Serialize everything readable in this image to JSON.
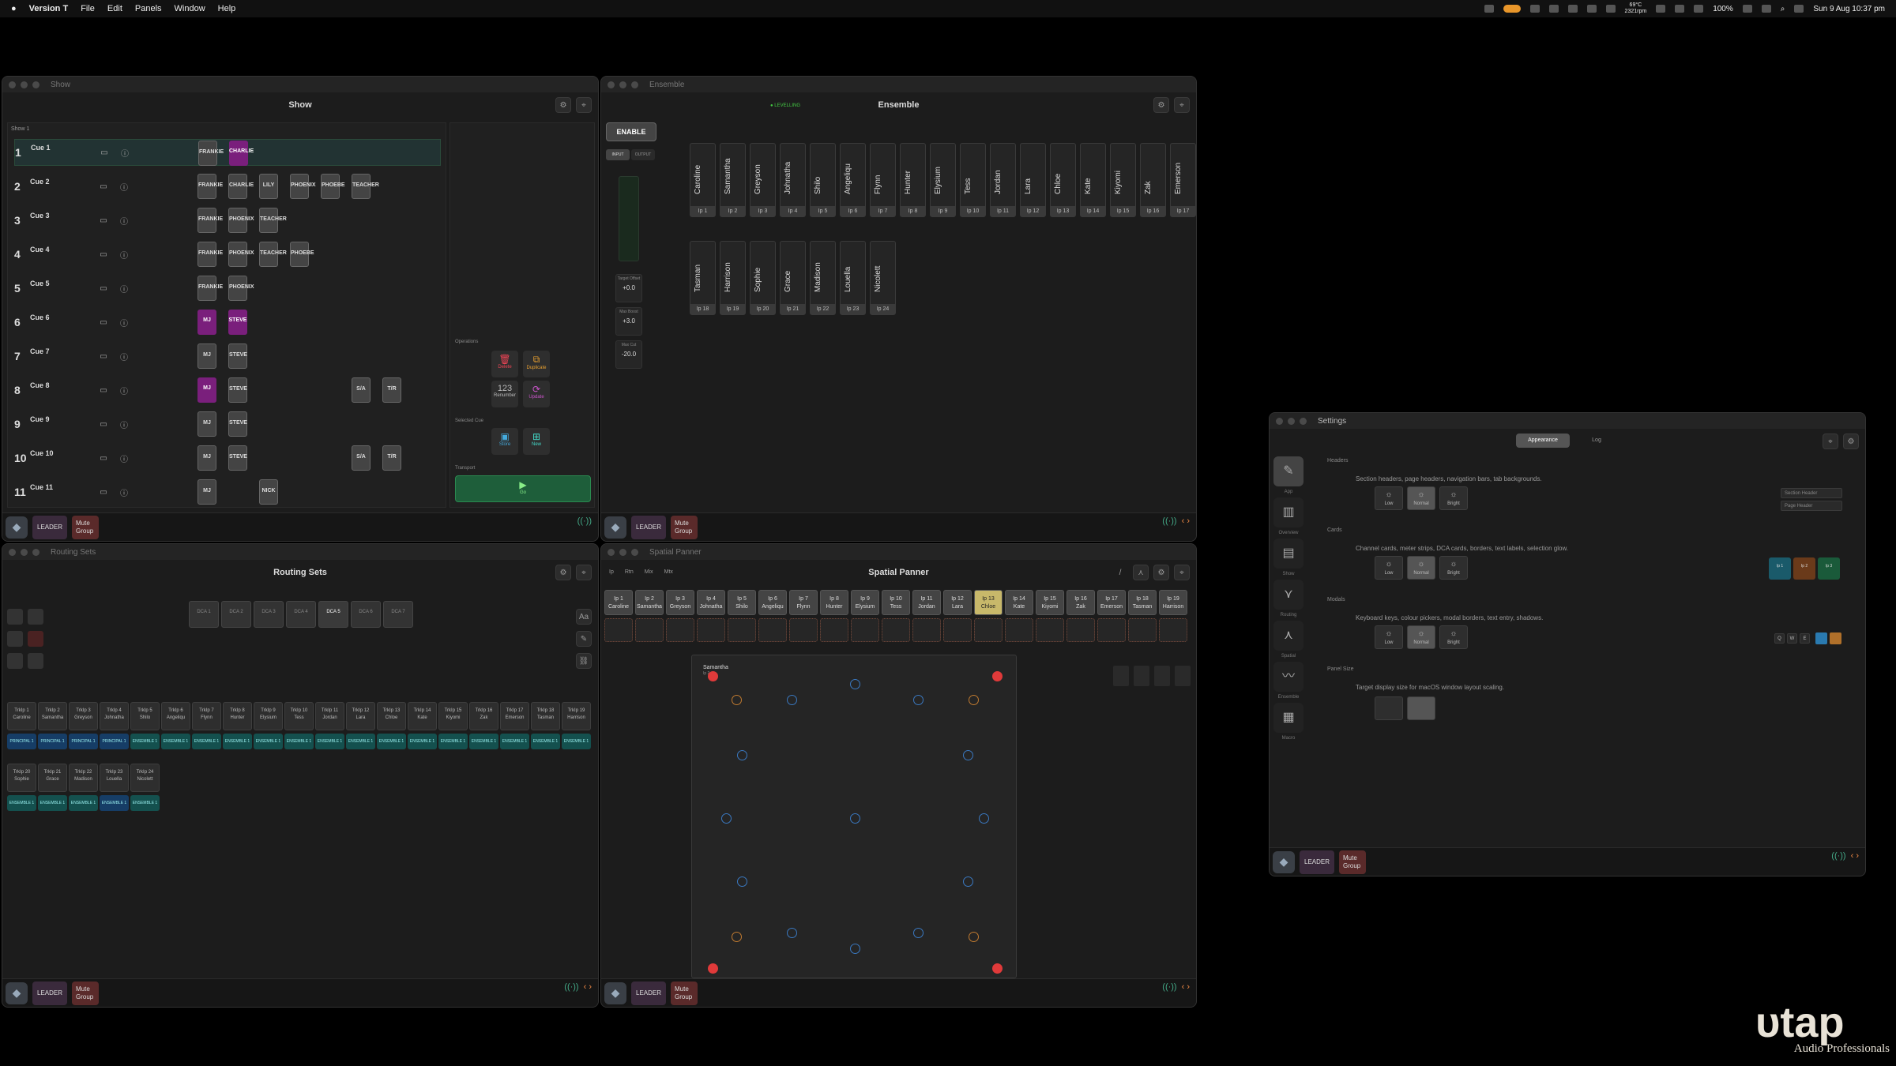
{
  "menubar": {
    "app_name": "Version T",
    "menus": [
      "File",
      "Edit",
      "Panels",
      "Window",
      "Help"
    ],
    "status": {
      "temp": "69°C",
      "rpm": "2321rpm",
      "battery": "100%",
      "datetime": "Sun 9 Aug  10:37 pm"
    }
  },
  "show": {
    "window_title": "Show",
    "header": "Show",
    "breadcrumb": "Show 1",
    "cues": [
      {
        "num": "1",
        "name": "Cue 1",
        "slots": [
          [
            "FRANKIE",
            "on"
          ],
          [
            "CHARLIE",
            "pur"
          ]
        ]
      },
      {
        "num": "2",
        "name": "Cue 2",
        "slots": [
          [
            "FRANKIE",
            "on"
          ],
          [
            "CHARLIE",
            "on"
          ],
          [
            "LILY",
            "on"
          ],
          [
            "PHOENIX",
            "on"
          ],
          [
            "PHOEBE",
            "on"
          ],
          [
            "TEACHER",
            "on"
          ]
        ]
      },
      {
        "num": "3",
        "name": "Cue 3",
        "slots": [
          [
            "FRANKIE",
            "on"
          ],
          [
            "PHOENIX",
            "on"
          ],
          [
            "TEACHER",
            "on"
          ]
        ]
      },
      {
        "num": "4",
        "name": "Cue 4",
        "slots": [
          [
            "FRANKIE",
            "on"
          ],
          [
            "PHOENIX",
            "on"
          ],
          [
            "TEACHER",
            "on"
          ],
          [
            "PHOEBE",
            "on"
          ]
        ]
      },
      {
        "num": "5",
        "name": "Cue 5",
        "slots": [
          [
            "FRANKIE",
            "on"
          ],
          [
            "PHOENIX",
            "on"
          ]
        ]
      },
      {
        "num": "6",
        "name": "Cue 6",
        "slots": [
          [
            "MJ",
            "pur"
          ],
          [
            "STEVE",
            "pur"
          ]
        ]
      },
      {
        "num": "7",
        "name": "Cue 7",
        "slots": [
          [
            "MJ",
            "on"
          ],
          [
            "STEVE",
            "on"
          ]
        ]
      },
      {
        "num": "8",
        "name": "Cue 8",
        "slots": [
          [
            "MJ",
            "pur"
          ],
          [
            "STEVE",
            "on"
          ],
          [
            "",
            ""
          ],
          [
            "",
            ""
          ],
          [
            "",
            ""
          ],
          [
            "S/A",
            "on"
          ],
          [
            "T/R",
            "on"
          ]
        ]
      },
      {
        "num": "9",
        "name": "Cue 9",
        "slots": [
          [
            "MJ",
            "on"
          ],
          [
            "STEVE",
            "on"
          ]
        ]
      },
      {
        "num": "10",
        "name": "Cue 10",
        "slots": [
          [
            "MJ",
            "on"
          ],
          [
            "STEVE",
            "on"
          ],
          [
            "",
            ""
          ],
          [
            "",
            ""
          ],
          [
            "",
            ""
          ],
          [
            "S/A",
            "on"
          ],
          [
            "T/R",
            "on"
          ]
        ]
      },
      {
        "num": "11",
        "name": "Cue 11",
        "slots": [
          [
            "MJ",
            "on"
          ],
          [
            "",
            ""
          ],
          [
            "NICK",
            "on"
          ]
        ]
      }
    ],
    "operations": {
      "label": "Operations",
      "delete": "Delete",
      "duplicate": "Duplicate",
      "renumber": "Renumber",
      "renumber_value": "123",
      "update": "Update"
    },
    "selected": {
      "label": "Selected Cue",
      "store": "Store",
      "new": "New"
    },
    "transport": {
      "label": "Transport",
      "go": "Go"
    }
  },
  "ensemble": {
    "window_title": "Ensemble",
    "header": "Ensemble",
    "status": "LEVELLING",
    "enable": "ENABLE",
    "input": "INPUT",
    "output": "OUTPUT",
    "readouts": [
      {
        "label": "Target Offset",
        "value": "+0.0"
      },
      {
        "label": "Max Boost",
        "value": "+3.0"
      },
      {
        "label": "Max Cut",
        "value": "-20.0"
      }
    ],
    "channels": [
      "Caroline",
      "Samantha",
      "Greyson",
      "Johnatha",
      "Shilo",
      "Angeliqu",
      "Flynn",
      "Hunter",
      "Elysium",
      "Tess",
      "Jordan",
      "Lara",
      "Chloe",
      "Kate",
      "Kiyomi",
      "Zak",
      "Emerson",
      "Tasman",
      "Harrison",
      "Sophie",
      "Grace",
      "Madison",
      "Louella",
      "Nicolett"
    ],
    "ips": [
      "Ip 1",
      "Ip 2",
      "Ip 3",
      "Ip 4",
      "Ip 5",
      "Ip 6",
      "Ip 7",
      "Ip 8",
      "Ip 9",
      "Ip 10",
      "Ip 11",
      "Ip 12",
      "Ip 13",
      "Ip 14",
      "Ip 15",
      "Ip 16",
      "Ip 17",
      "Ip 18",
      "Ip 19",
      "Ip 20",
      "Ip 21",
      "Ip 22",
      "Ip 23",
      "Ip 24"
    ]
  },
  "routing": {
    "window_title": "Routing Sets",
    "header": "Routing Sets",
    "dcas": [
      "DCA 1",
      "DCA 2",
      "DCA 3",
      "DCA 4",
      "DCA 5",
      "DCA 6",
      "DCA 7"
    ],
    "tracks": [
      "TrkIp 1",
      "TrkIp 2",
      "TrkIp 3",
      "TrkIp 4",
      "TrkIp 5",
      "TrkIp 6",
      "TrkIp 7",
      "TrkIp 8",
      "TrkIp 9",
      "TrkIp 10",
      "TrkIp 11",
      "TrkIp 12",
      "TrkIp 13",
      "TrkIp 14",
      "TrkIp 15",
      "TrkIp 16",
      "TrkIp 17",
      "TrkIp 18",
      "TrkIp 19",
      "TrkIp 20",
      "TrkIp 21",
      "TrkIp 22",
      "TrkIp 23",
      "TrkIp 24"
    ],
    "principal": "PRINCIPAL 1",
    "ensemble": "ENSEMBLE 1"
  },
  "spatial": {
    "window_title": "Spatial Panner",
    "header": "Spatial Panner",
    "tabs": [
      "Ip",
      "Rtn",
      "Mix",
      "Mtx"
    ],
    "chips": [
      "Ip 1",
      "Ip 2",
      "Ip 3",
      "Ip 4",
      "Ip 5",
      "Ip 6",
      "Ip 7",
      "Ip 8",
      "Ip 9",
      "Ip 10",
      "Ip 11",
      "Ip 12",
      "Ip 13",
      "Ip 14",
      "Ip 15",
      "Ip 16",
      "Ip 17",
      "Ip 18",
      "Ip 19"
    ],
    "selected_name": "Samantha",
    "selected_ip": "Ip 2"
  },
  "settings": {
    "window_title": "Settings",
    "tabs": [
      "Appearance",
      "Log"
    ],
    "nav": [
      "App",
      "Overview",
      "Show",
      "Routing",
      "Spatial",
      "Ensemble",
      "Macro"
    ],
    "sections": [
      {
        "title": "Headers",
        "desc": "Section headers, page headers, navigation bars, tab backgrounds."
      },
      {
        "title": "Cards",
        "desc": "Channel cards, meter strips, DCA cards, borders, text labels, selection glow."
      },
      {
        "title": "Modals",
        "desc": "Keyboard keys, colour pickers, modal borders, text entry, shadows."
      },
      {
        "title": "Panel Size",
        "desc": "Target display size for macOS window layout scaling."
      }
    ],
    "levels": [
      "Low",
      "Normal",
      "Bright"
    ],
    "header_previews": [
      "Section Header",
      "Page Header"
    ],
    "keys": [
      "Q",
      "W",
      "E"
    ]
  },
  "footer": {
    "leader": "LEADER",
    "mute": "Mute Group"
  },
  "brand": {
    "name": "Audio Professionals"
  }
}
